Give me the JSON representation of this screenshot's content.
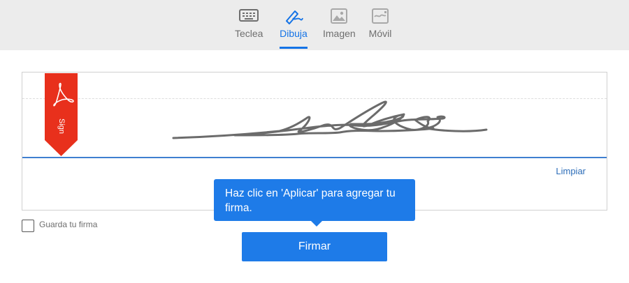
{
  "tabs": [
    {
      "label": "Teclea",
      "icon": "keyboard-icon"
    },
    {
      "label": "Dibuja",
      "icon": "pen-draw-icon",
      "active": true
    },
    {
      "label": "Imagen",
      "icon": "image-icon"
    },
    {
      "label": "Móvil",
      "icon": "mobile-signature-icon"
    }
  ],
  "ribbon": {
    "label": "Sign",
    "icon": "acrobat-icon"
  },
  "signature_area": {
    "clear_label": "Limpiar"
  },
  "save_signature": {
    "label": "Guarda tu firma",
    "checked": false
  },
  "tooltip": {
    "text": "Haz clic en 'Aplicar' para agregar tu firma."
  },
  "primary_button": {
    "label": "Firmar"
  },
  "colors": {
    "accent": "#1473e6",
    "ribbon": "#e8301c",
    "topbar": "#ececec"
  }
}
